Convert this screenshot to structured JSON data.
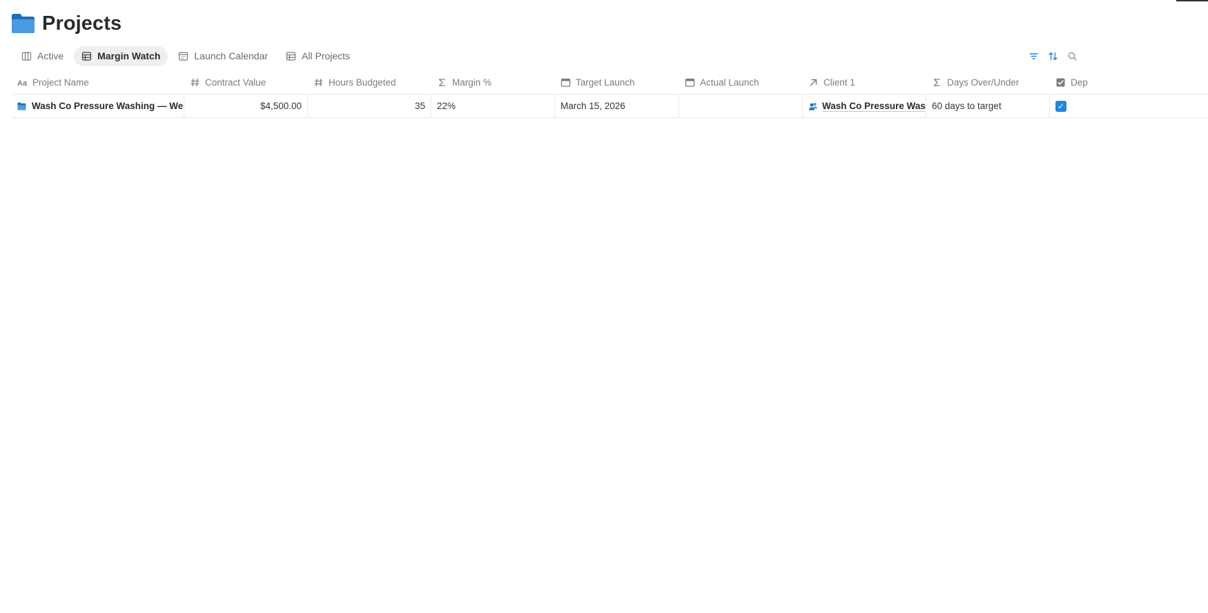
{
  "page": {
    "title": "Projects",
    "title_icon": "folder-icon"
  },
  "tabs": [
    {
      "label": "Active",
      "icon": "board-icon",
      "active": false
    },
    {
      "label": "Margin Watch",
      "icon": "table-icon",
      "active": true
    },
    {
      "label": "Launch Calendar",
      "icon": "calendar-icon",
      "active": false
    },
    {
      "label": "All Projects",
      "icon": "table-icon",
      "active": false
    }
  ],
  "toolbar": {
    "filter_icon": "filter-icon",
    "sort_icon": "sort-icon",
    "search_icon": "search-icon",
    "accent_color": "#2383e2"
  },
  "table": {
    "columns": [
      {
        "label": "Project Name",
        "icon": "text-property-icon"
      },
      {
        "label": "Contract Value",
        "icon": "number-property-icon"
      },
      {
        "label": "Hours Budgeted",
        "icon": "number-property-icon"
      },
      {
        "label": "Margin %",
        "icon": "formula-icon"
      },
      {
        "label": "Target Launch",
        "icon": "date-icon"
      },
      {
        "label": "Actual Launch",
        "icon": "date-icon"
      },
      {
        "label": "Client 1",
        "icon": "relation-arrow-icon"
      },
      {
        "label": "Days Over/Under",
        "icon": "formula-icon"
      },
      {
        "label": "Dep",
        "icon": "checkbox-property-icon"
      }
    ],
    "rows": [
      {
        "project_name": "Wash Co Pressure Washing — Website",
        "contract_value": "$4,500.00",
        "hours_budgeted": "35",
        "margin": "22%",
        "target_launch": "March 15, 2026",
        "actual_launch": "",
        "client": "Wash Co Pressure Washing",
        "days_over_under": "60 days to target",
        "dep_checked": true
      }
    ]
  }
}
